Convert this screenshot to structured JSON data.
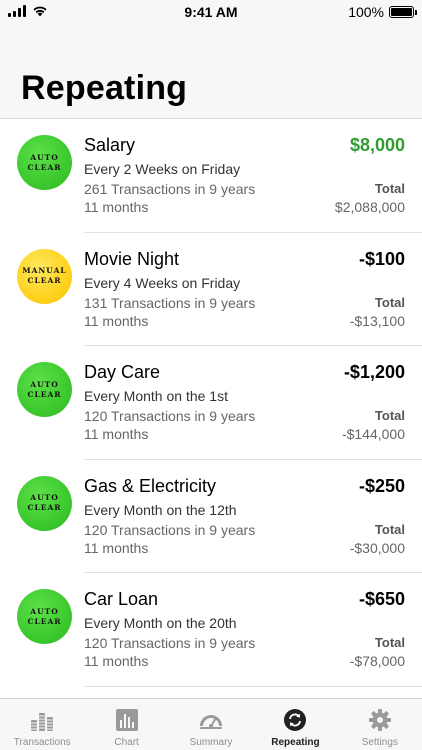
{
  "status_bar": {
    "time": "9:41 AM",
    "battery": "100%"
  },
  "header": {
    "title": "Repeating"
  },
  "colors": {
    "positive": "#2f9e2f",
    "auto_badge": "#3cc92e",
    "manual_badge": "#ffd21e",
    "inactive_tab": "#8e8e8e"
  },
  "items": [
    {
      "badge_line1": "AUTO",
      "badge_line2": "CLEAR",
      "badge_type": "auto",
      "name": "Salary",
      "schedule": "Every 2 Weeks on Friday",
      "transactions": "261 Transactions in 9 years",
      "duration": "11 months",
      "amount": "$8,000",
      "amount_type": "positive",
      "total_label": "Total",
      "total": "$2,088,000"
    },
    {
      "badge_line1": "MANUAL",
      "badge_line2": "CLEAR",
      "badge_type": "manual",
      "name": "Movie Night",
      "schedule": "Every 4 Weeks on Friday",
      "transactions": "131 Transactions in 9 years",
      "duration": "11 months",
      "amount": "-$100",
      "amount_type": "negative",
      "total_label": "Total",
      "total": "-$13,100"
    },
    {
      "badge_line1": "AUTO",
      "badge_line2": "CLEAR",
      "badge_type": "auto",
      "name": "Day Care",
      "schedule": "Every Month on the 1st",
      "transactions": "120 Transactions in 9 years",
      "duration": "11 months",
      "amount": "-$1,200",
      "amount_type": "negative",
      "total_label": "Total",
      "total": "-$144,000"
    },
    {
      "badge_line1": "AUTO",
      "badge_line2": "CLEAR",
      "badge_type": "auto",
      "name": "Gas & Electricity",
      "schedule": "Every Month on the 12th",
      "transactions": "120 Transactions in 9 years",
      "duration": "11 months",
      "amount": "-$250",
      "amount_type": "negative",
      "total_label": "Total",
      "total": "-$30,000"
    },
    {
      "badge_line1": "AUTO",
      "badge_line2": "CLEAR",
      "badge_type": "auto",
      "name": "Car Loan",
      "schedule": "Every Month on the 20th",
      "transactions": "120 Transactions in 9 years",
      "duration": "11 months",
      "amount": "-$650",
      "amount_type": "negative",
      "total_label": "Total",
      "total": "-$78,000"
    }
  ],
  "tabs": [
    {
      "label": "Transactions",
      "icon": "coins-stack-icon",
      "active": false
    },
    {
      "label": "Chart",
      "icon": "bar-chart-icon",
      "active": false
    },
    {
      "label": "Summary",
      "icon": "gauge-icon",
      "active": false
    },
    {
      "label": "Repeating",
      "icon": "repeat-cycle-icon",
      "active": true
    },
    {
      "label": "Settings",
      "icon": "gear-icon",
      "active": false
    }
  ]
}
